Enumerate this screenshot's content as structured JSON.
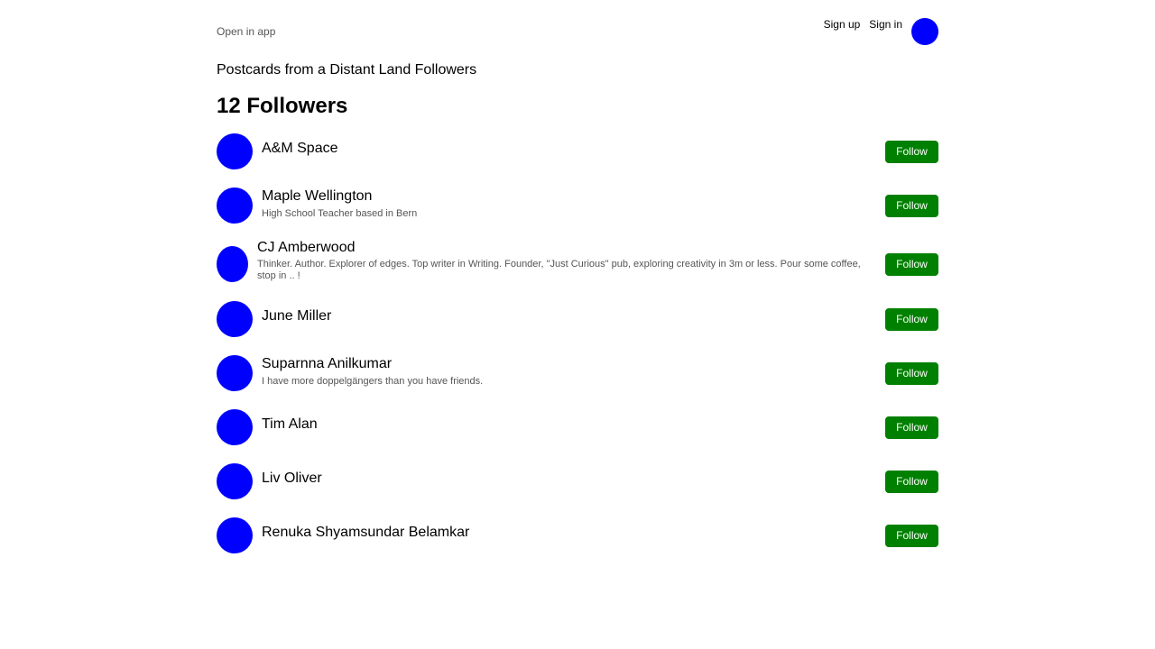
{
  "header": {
    "open_in_app": "Open in app",
    "sign_up": "Sign up",
    "sign_in": "Sign in"
  },
  "publication": {
    "title": "Postcards from a Distant Land Followers",
    "count_heading": "12 Followers"
  },
  "followers": [
    {
      "name": "A&M Space",
      "bio": "",
      "button": "Follow"
    },
    {
      "name": "Maple Wellington",
      "bio": "High School Teacher based in Bern",
      "button": "Follow"
    },
    {
      "name": "CJ Amberwood",
      "bio": "Thinker. Author. Explorer of edges. Top writer in Writing. Founder, \"Just Curious\" pub, exploring creativity in 3m or less. Pour some coffee, stop in .. !",
      "button": "Follow"
    },
    {
      "name": "June Miller",
      "bio": "",
      "button": "Follow"
    },
    {
      "name": "Suparnna Anilkumar",
      "bio": "I have more doppelgängers than you have friends.",
      "button": "Follow"
    },
    {
      "name": "Tim Alan",
      "bio": "",
      "button": "Follow"
    },
    {
      "name": "Liv Oliver",
      "bio": "",
      "button": "Follow"
    },
    {
      "name": "Renuka Shyamsundar Belamkar",
      "bio": "",
      "button": "Follow"
    }
  ],
  "colors": {
    "avatar": "#0000ff",
    "follow_button": "#008000"
  }
}
